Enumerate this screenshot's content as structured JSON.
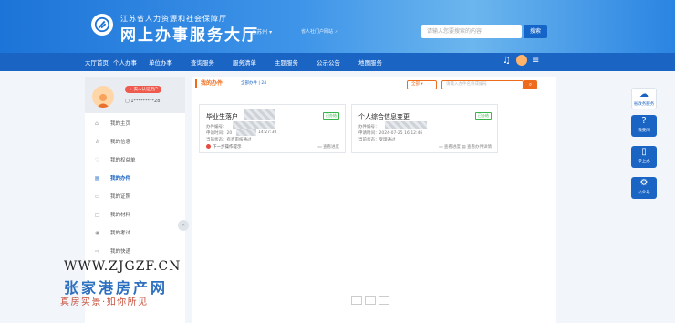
{
  "header": {
    "org_name": "江苏省人力资源和社会保障厅",
    "site_title": "网上办事服务大厅",
    "city": "◎苏州 ▾",
    "tag_link": "省人社门户网站 ↗",
    "search_placeholder": "请输入您要搜索的内容",
    "search_button": "搜索"
  },
  "nav": {
    "items": [
      "大厅首页",
      "个人办事",
      "单位办事",
      "查询服务",
      "服务清单",
      "主题服务",
      "公示公告",
      "地图服务"
    ]
  },
  "sidebar": {
    "badge": "☆ 实人认证用户",
    "user_id": "1*********28",
    "menu": [
      {
        "label": "我的主页",
        "icon": "⌂"
      },
      {
        "label": "我的信息",
        "icon": "♙"
      },
      {
        "label": "我的权益单",
        "icon": "♡"
      },
      {
        "label": "我的办件",
        "icon": "▤"
      },
      {
        "label": "我的证照",
        "icon": "▭"
      },
      {
        "label": "我的材料",
        "icon": "□"
      },
      {
        "label": "我的考试",
        "icon": "◉"
      },
      {
        "label": "我的快递",
        "icon": "⇨"
      }
    ],
    "collapse": "«"
  },
  "main": {
    "tab_title": "我的办件",
    "tab_all": "全部办件 | 24",
    "filter": "全部 ▾",
    "search_placeholder": "请输入办件名称或编号",
    "search_icon": "⌕",
    "cards": [
      {
        "title": "毕业生落户",
        "status": "已办结",
        "number_label": "办件编号：",
        "apply_time": "申请时间：20",
        "apply_time_tail": "14:27:38",
        "current_status": "当前状态：有直审核通过",
        "foot_left": "下一步操作提示",
        "foot_right": "▭ 查看进度"
      },
      {
        "title": "个人综合信息变更",
        "status": "已办结",
        "number_label": "办件编号：",
        "apply_time": "申请时间：2024-07-25 16:12:46",
        "apply_time_tail": "",
        "current_status": "当前状态：受理通过",
        "foot_left": "",
        "foot_right": "▭ 查看进度  ▤ 查看办件详情"
      }
    ]
  },
  "floats": [
    {
      "icon": "☁",
      "label": "省政务服务"
    },
    {
      "icon": "?",
      "label": "我要问"
    },
    {
      "icon": "▯",
      "label": "掌上办"
    },
    {
      "icon": "⚙",
      "label": "公众号"
    }
  ],
  "watermark": {
    "url": "WWW.ZJGZF.CN",
    "name": "张家港房产网",
    "slogan": "真房实景·如你所见"
  }
}
